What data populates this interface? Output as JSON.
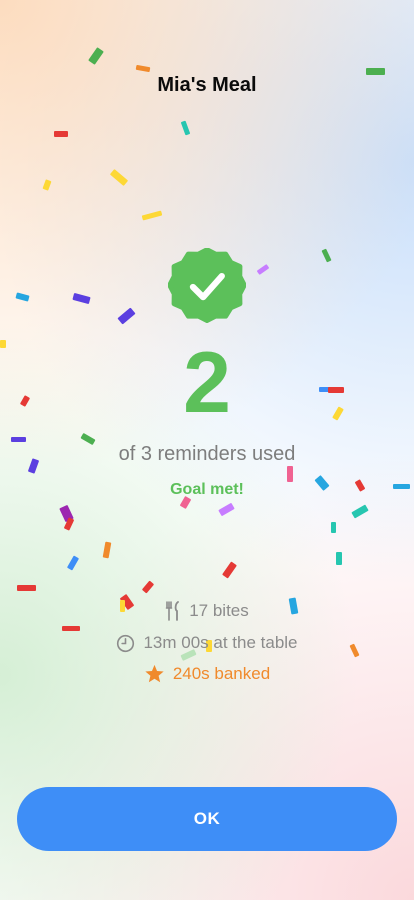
{
  "header": {
    "title": "Mia's Meal"
  },
  "result": {
    "badge_icon": "check-badge-icon",
    "reminders_used": "2",
    "reminders_text": "of 3 reminders used",
    "goal_text": "Goal met!"
  },
  "stats": {
    "bites": {
      "icon": "fork-knife-icon",
      "text": "17 bites"
    },
    "time": {
      "icon": "clock-icon",
      "text": "13m 00s at the table"
    },
    "banked": {
      "icon": "star-icon",
      "text": "240s banked"
    }
  },
  "actions": {
    "ok_label": "OK"
  },
  "colors": {
    "success_green": "#5cc05a",
    "primary_blue": "#3e8ef7",
    "accent_orange": "#f08a2c",
    "muted_text": "#8b8b8b"
  }
}
